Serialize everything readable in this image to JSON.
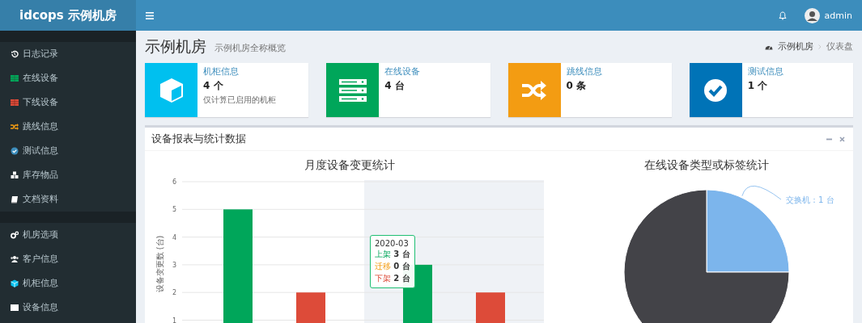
{
  "header": {
    "logo": "idcops 示例机房",
    "user": "admin"
  },
  "sidebar": {
    "sections": [
      {
        "items": [
          {
            "label": "日志记录"
          },
          {
            "label": "在线设备"
          },
          {
            "label": "下线设备"
          },
          {
            "label": "跳线信息"
          },
          {
            "label": "测试信息"
          },
          {
            "label": "库存物品"
          },
          {
            "label": "文档资料"
          }
        ]
      },
      {
        "items": [
          {
            "label": "机房选项"
          },
          {
            "label": "客户信息"
          },
          {
            "label": "机柜信息"
          },
          {
            "label": "设备信息"
          }
        ]
      }
    ]
  },
  "page": {
    "title": "示例机房",
    "subtitle": "示例机房全称概览",
    "breadcrumb": [
      "示例机房",
      "仪表盘"
    ]
  },
  "info_boxes": [
    {
      "title": "机柜信息",
      "value": "4 个",
      "description": "仅计算已启用的机柜",
      "color": "#00c0ef"
    },
    {
      "title": "在线设备",
      "value": "4 台",
      "color": "#00a65a"
    },
    {
      "title": "跳线信息",
      "value": "0 条",
      "color": "#f39c12"
    },
    {
      "title": "测试信息",
      "value": "1 个",
      "color": "#0073b7"
    }
  ],
  "panel": {
    "title": "设备报表与统计数据",
    "bar_chart": {
      "chart_data": {
        "type": "bar",
        "title": "月度设备变更统计",
        "ylabel": "设备变更数 (台)",
        "ylim": [
          0,
          6
        ],
        "yticks": [
          1,
          2,
          3,
          4,
          5,
          6
        ],
        "grid": true,
        "series": [
          {
            "color": "#00a65a",
            "values": [
              5,
              3
            ]
          },
          {
            "color": "#f39c12",
            "values": [
              0,
              0
            ]
          },
          {
            "color": "#dd4b39",
            "values": [
              2,
              2
            ]
          }
        ]
      },
      "tooltip": {
        "title": "2020-03",
        "rows": [
          {
            "label": "上架",
            "value": "3 台"
          },
          {
            "label": "迁移",
            "value": "0 台"
          },
          {
            "label": "下架",
            "value": "2 台"
          }
        ]
      }
    },
    "pie_chart": {
      "chart_data": {
        "type": "pie",
        "title": "在线设备类型或标签统计",
        "series": [
          {
            "values": [
              25,
              75
            ]
          }
        ],
        "value_labels": [
          "交换机：1 台",
          null
        ]
      }
    }
  }
}
